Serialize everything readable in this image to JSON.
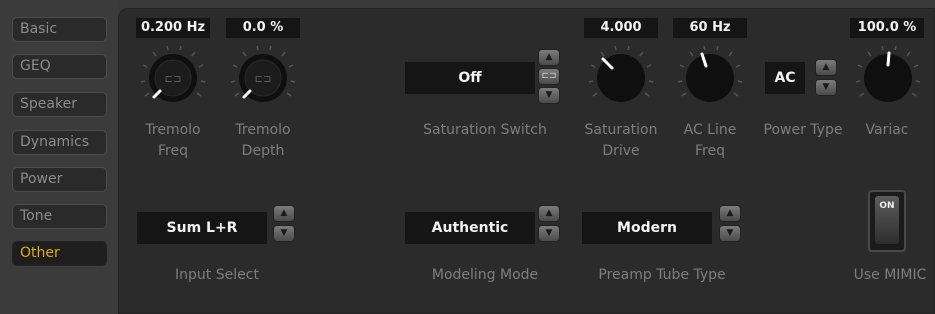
{
  "sidebar": {
    "tabs": [
      {
        "label": "Basic"
      },
      {
        "label": "GEQ"
      },
      {
        "label": "Speaker"
      },
      {
        "label": "Dynamics"
      },
      {
        "label": "Power"
      },
      {
        "label": "Tone"
      },
      {
        "label": "Other",
        "active": true
      }
    ]
  },
  "controls": {
    "tremolo_freq": {
      "value": "0.200 Hz",
      "label_line1": "Tremolo",
      "label_line2": "Freq"
    },
    "tremolo_depth": {
      "value": "0.0 %",
      "label_line1": "Tremolo",
      "label_line2": "Depth"
    },
    "saturation_switch": {
      "value": "Off",
      "label": "Saturation Switch"
    },
    "saturation_drive": {
      "value": "4.000",
      "label_line1": "Saturation",
      "label_line2": "Drive"
    },
    "ac_line_freq": {
      "value": "60 Hz",
      "label_line1": "AC Line",
      "label_line2": "Freq"
    },
    "power_type": {
      "value": "AC",
      "label": "Power Type"
    },
    "variac": {
      "value": "100.0 %",
      "label": "Variac"
    },
    "input_select": {
      "value": "Sum L+R",
      "label": "Input Select"
    },
    "modeling_mode": {
      "value": "Authentic",
      "label": "Modeling Mode"
    },
    "preamp_tube_type": {
      "value": "Modern",
      "label": "Preamp Tube Type"
    },
    "use_mimic": {
      "label": "Use MIMIC",
      "switch_text": "ON"
    }
  },
  "icons": {
    "spin_up": "▲",
    "spin_down": "▼",
    "spin_link": "⊏⊐"
  },
  "colors": {
    "accent": "#e0a81c",
    "panel": "#2b2b2b",
    "readout_bg": "#151515"
  }
}
